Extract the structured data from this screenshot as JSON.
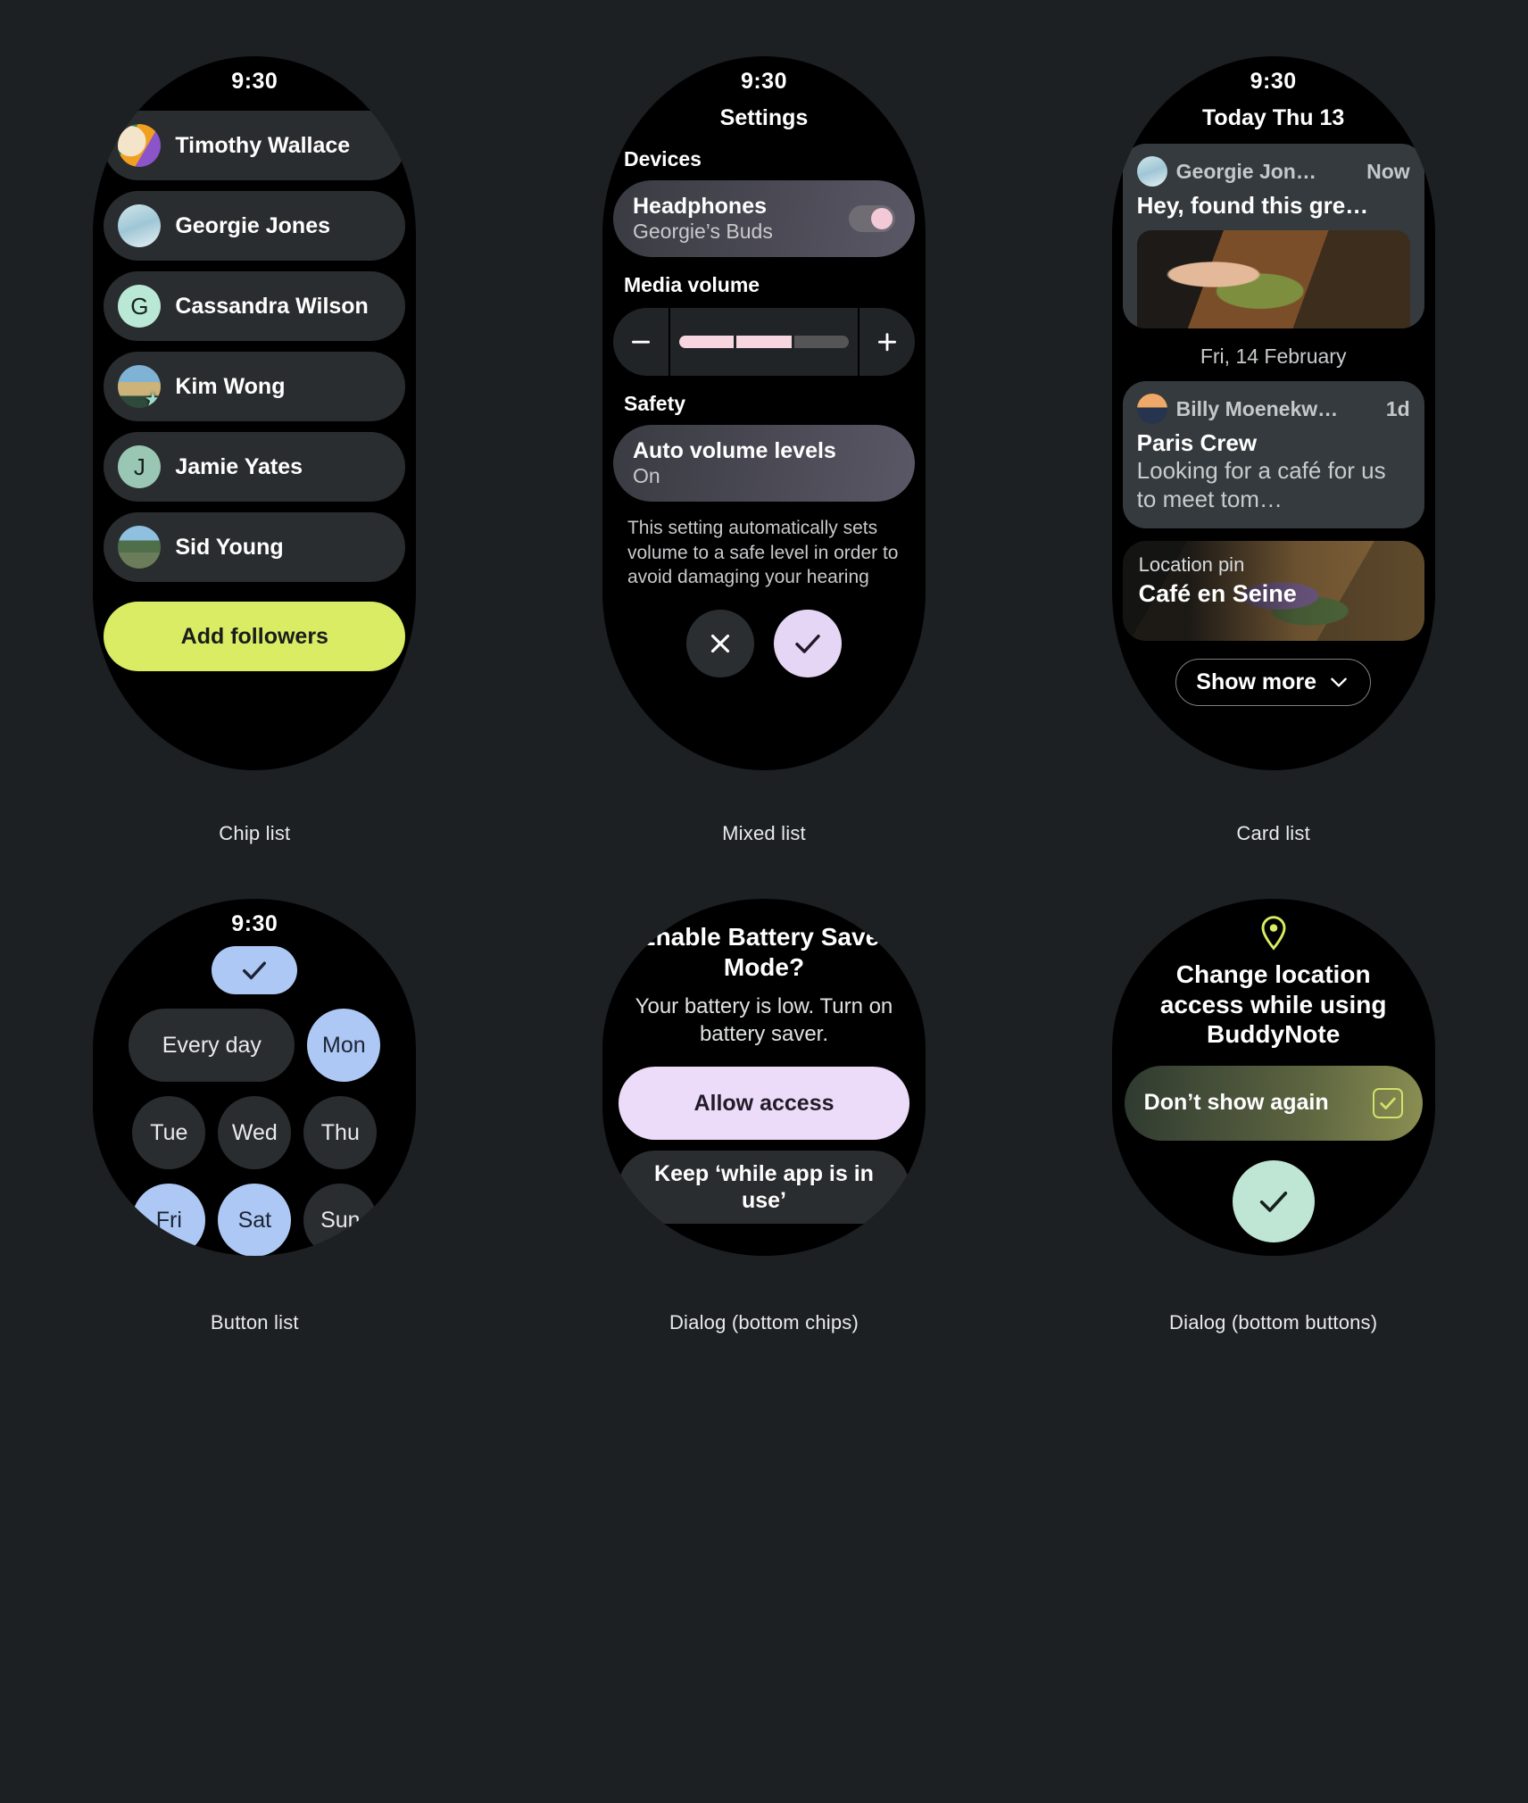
{
  "theme": {
    "page_bg": "#1c2023",
    "watch_bg": "#000000",
    "chip_bg": "#2a2d2f",
    "accent_lime": "#d9ec63",
    "accent_blue": "#adc8f5",
    "accent_lilac": "#e6d6f5",
    "accent_pink": "#f8d6e0",
    "accent_mint": "#bfe6d4"
  },
  "chip_list": {
    "caption": "Chip list",
    "time": "9:30",
    "items": [
      {
        "name": "Timothy Wallace",
        "avatar": "photo-avatar",
        "badge": ""
      },
      {
        "name": "Georgie Jones",
        "avatar": "photo-avatar",
        "badge": ""
      },
      {
        "name": "Cassandra Wilson",
        "avatar": "initial-avatar",
        "initial": "G",
        "badge": ""
      },
      {
        "name": "Kim Wong",
        "avatar": "photo-avatar",
        "badge": "star-icon"
      },
      {
        "name": "Jamie Yates",
        "avatar": "initial-avatar",
        "initial": "J",
        "badge": ""
      },
      {
        "name": "Sid Young",
        "avatar": "photo-avatar",
        "badge": ""
      }
    ],
    "cta_label": "Add followers"
  },
  "mixed_list": {
    "caption": "Mixed list",
    "time": "9:30",
    "title": "Settings",
    "section_devices": "Devices",
    "headphones": {
      "title": "Headphones",
      "subtitle": "Georgie’s Buds",
      "toggle_state": "on"
    },
    "media_volume_label": "Media volume",
    "volume": {
      "minus_label": "−",
      "plus_label": "+",
      "segments_total": 3,
      "segments_filled": 2
    },
    "section_safety": "Safety",
    "auto_volume": {
      "title": "Auto volume levels",
      "value": "On"
    },
    "help_text": "This setting automatically sets volume to a safe level in order to avoid damaging your hearing",
    "actions": {
      "dismiss": "close-icon",
      "confirm": "check-icon"
    }
  },
  "card_list": {
    "caption": "Card list",
    "time": "9:30",
    "title": "Today Thu 13",
    "cards": [
      {
        "sender": "Georgie Jon…",
        "time": "Now",
        "message": "Hey, found this gre…",
        "has_image": true
      }
    ],
    "day_separator": "Fri, 14 February",
    "cards2": [
      {
        "sender": "Billy Moenekw…",
        "time": "1d",
        "title": "Paris Crew",
        "message": "Looking for a café for us to meet tom…"
      }
    ],
    "location_card": {
      "label": "Location pin",
      "name": "Café en Seine"
    },
    "show_more_label": "Show more",
    "show_more_icon": "chevron-down-icon"
  },
  "button_list": {
    "caption": "Button list",
    "time": "9:30",
    "top_check_icon": "check-icon",
    "rows": [
      [
        {
          "label": "Every day",
          "shape": "wide",
          "selected": false
        },
        {
          "label": "Mon",
          "shape": "circle",
          "selected": true
        }
      ],
      [
        {
          "label": "Tue",
          "shape": "circle",
          "selected": false
        },
        {
          "label": "Wed",
          "shape": "circle",
          "selected": false
        },
        {
          "label": "Thu",
          "shape": "circle",
          "selected": false
        }
      ],
      [
        {
          "label": "Fri",
          "shape": "circle",
          "selected": true
        },
        {
          "label": "Sat",
          "shape": "circle",
          "selected": true
        },
        {
          "label": "Sun",
          "shape": "circle",
          "selected": false
        }
      ]
    ]
  },
  "dialog_chips": {
    "caption": "Dialog (bottom chips)",
    "title": "Enable Battery Saver Mode?",
    "body": "Your battery is low. Turn on battery saver.",
    "primary_label": "Allow access",
    "secondary_label": "Keep ‘while app is in use’"
  },
  "dialog_buttons": {
    "caption": "Dialog (bottom buttons)",
    "pin_icon": "location-pin-icon",
    "title": "Change location access while using BuddyNote",
    "checkbox_label": "Don’t show again",
    "checkbox_state": "checked",
    "confirm_icon": "check-icon"
  }
}
